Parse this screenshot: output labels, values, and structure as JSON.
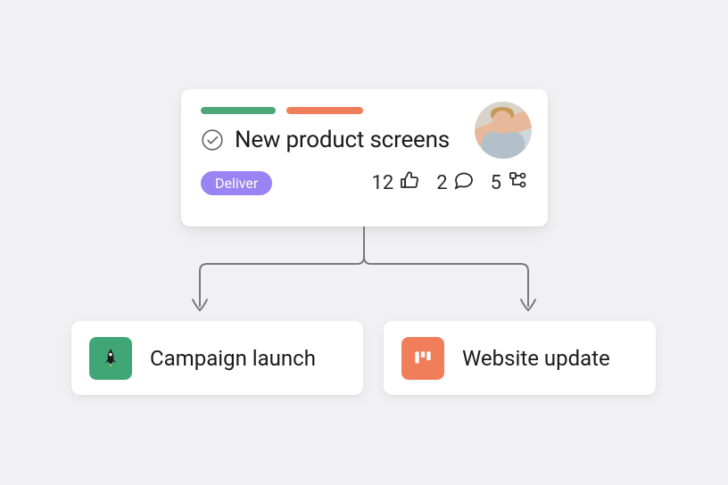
{
  "parent": {
    "title": "New product screens",
    "badge": "Deliver",
    "stats": {
      "likes": "12",
      "comments": "2",
      "subtasks": "5"
    },
    "tag_colors": {
      "green": "#4da779",
      "orange": "#f07e5b"
    }
  },
  "children": [
    {
      "icon": "rocket",
      "title": "Campaign launch"
    },
    {
      "icon": "board",
      "title": "Website update"
    }
  ]
}
